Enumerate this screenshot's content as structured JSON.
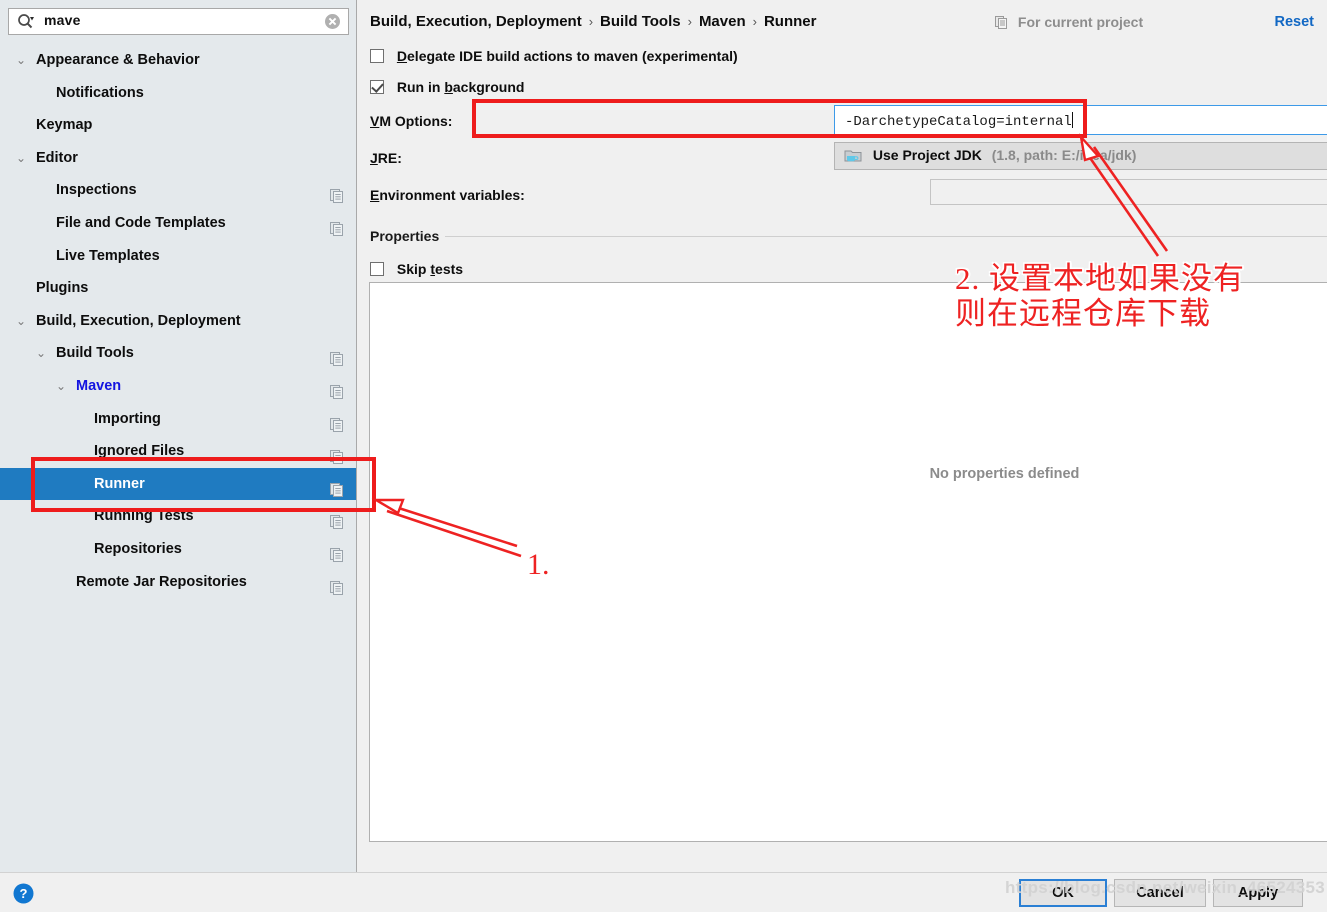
{
  "search": {
    "value": "mave",
    "icon": "search-icon",
    "clear_icon": "clear-icon"
  },
  "sidebar": {
    "items": [
      {
        "label": "Appearance & Behavior",
        "level": 0,
        "chevron": "⌄",
        "copy": false,
        "selected": false,
        "match": false
      },
      {
        "label": "Notifications",
        "level": 1,
        "chevron": "",
        "copy": false,
        "selected": false,
        "match": false
      },
      {
        "label": "Keymap",
        "level": 0,
        "chevron": "",
        "copy": false,
        "selected": false,
        "match": false
      },
      {
        "label": "Editor",
        "level": 0,
        "chevron": "⌄",
        "copy": false,
        "selected": false,
        "match": false
      },
      {
        "label": "Inspections",
        "level": 1,
        "chevron": "",
        "copy": true,
        "selected": false,
        "match": false
      },
      {
        "label": "File and Code Templates",
        "level": 1,
        "chevron": "",
        "copy": true,
        "selected": false,
        "match": false
      },
      {
        "label": "Live Templates",
        "level": 1,
        "chevron": "",
        "copy": false,
        "selected": false,
        "match": false
      },
      {
        "label": "Plugins",
        "level": 0,
        "chevron": "",
        "copy": false,
        "selected": false,
        "match": false
      },
      {
        "label": "Build, Execution, Deployment",
        "level": 0,
        "chevron": "⌄",
        "copy": false,
        "selected": false,
        "match": false
      },
      {
        "label": "Build Tools",
        "level": 1,
        "chevron": "⌄",
        "copy": true,
        "selected": false,
        "match": false
      },
      {
        "label": "Maven",
        "level": 2,
        "chevron": "⌄",
        "copy": true,
        "selected": false,
        "match": true
      },
      {
        "label": "Importing",
        "level": 3,
        "chevron": "",
        "copy": true,
        "selected": false,
        "match": false
      },
      {
        "label": "Ignored Files",
        "level": 3,
        "chevron": "",
        "copy": true,
        "selected": false,
        "match": false
      },
      {
        "label": "Runner",
        "level": 3,
        "chevron": "",
        "copy": true,
        "selected": true,
        "match": false
      },
      {
        "label": "Running Tests",
        "level": 3,
        "chevron": "",
        "copy": true,
        "selected": false,
        "match": false
      },
      {
        "label": "Repositories",
        "level": 3,
        "chevron": "",
        "copy": true,
        "selected": false,
        "match": false
      },
      {
        "label": "Remote Jar Repositories",
        "level": 2,
        "chevron": "",
        "copy": true,
        "selected": false,
        "match": false
      }
    ]
  },
  "header": {
    "breadcrumb": [
      "Build, Execution, Deployment",
      "Build Tools",
      "Maven",
      "Runner"
    ],
    "separator": "›",
    "scope_label": "For current project",
    "scope_icon": "copy-icon",
    "reset_label": "Reset"
  },
  "form": {
    "delegate": {
      "label": "Delegate IDE build actions to maven (experimental)",
      "checked": false,
      "mnemonic": "D"
    },
    "run_background": {
      "label": "Run in background",
      "checked": true,
      "mnemonic": "b"
    },
    "vm_options": {
      "label": "VM Options:",
      "value": "-DarchetypeCatalog=internal",
      "expand_icon": "expand-icon",
      "mnemonic": "V"
    },
    "jre": {
      "label": "JRE:",
      "value": "Use Project JDK",
      "detail": "(1.8, path: E:/idea/jdk)",
      "icon": "jdk-folder-icon",
      "chevron_icon": "chevron-down-icon",
      "mnemonic": "J"
    },
    "env": {
      "label": "Environment variables:",
      "value": "",
      "folder_icon": "folder-icon",
      "mnemonic": "E"
    },
    "properties_title": "Properties",
    "skip_tests": {
      "label": "Skip tests",
      "checked": false,
      "mnemonic": "t"
    },
    "empty_properties": "No properties defined",
    "toolbar": {
      "add_icon": "plus-icon",
      "remove_icon": "minus-icon",
      "edit_icon": "pencil-icon"
    }
  },
  "bottom": {
    "help_icon": "help-icon",
    "ok_label": "OK",
    "cancel_label": "Cancel",
    "apply_label": "Apply"
  },
  "annotations": {
    "step1": "1.",
    "step2_line1": "2. 设置本地如果没有",
    "step2_line2": "则在远程仓库下载",
    "color": "#ee2222"
  },
  "watermark": "https://blog.csdn.net/weixin_46524353"
}
